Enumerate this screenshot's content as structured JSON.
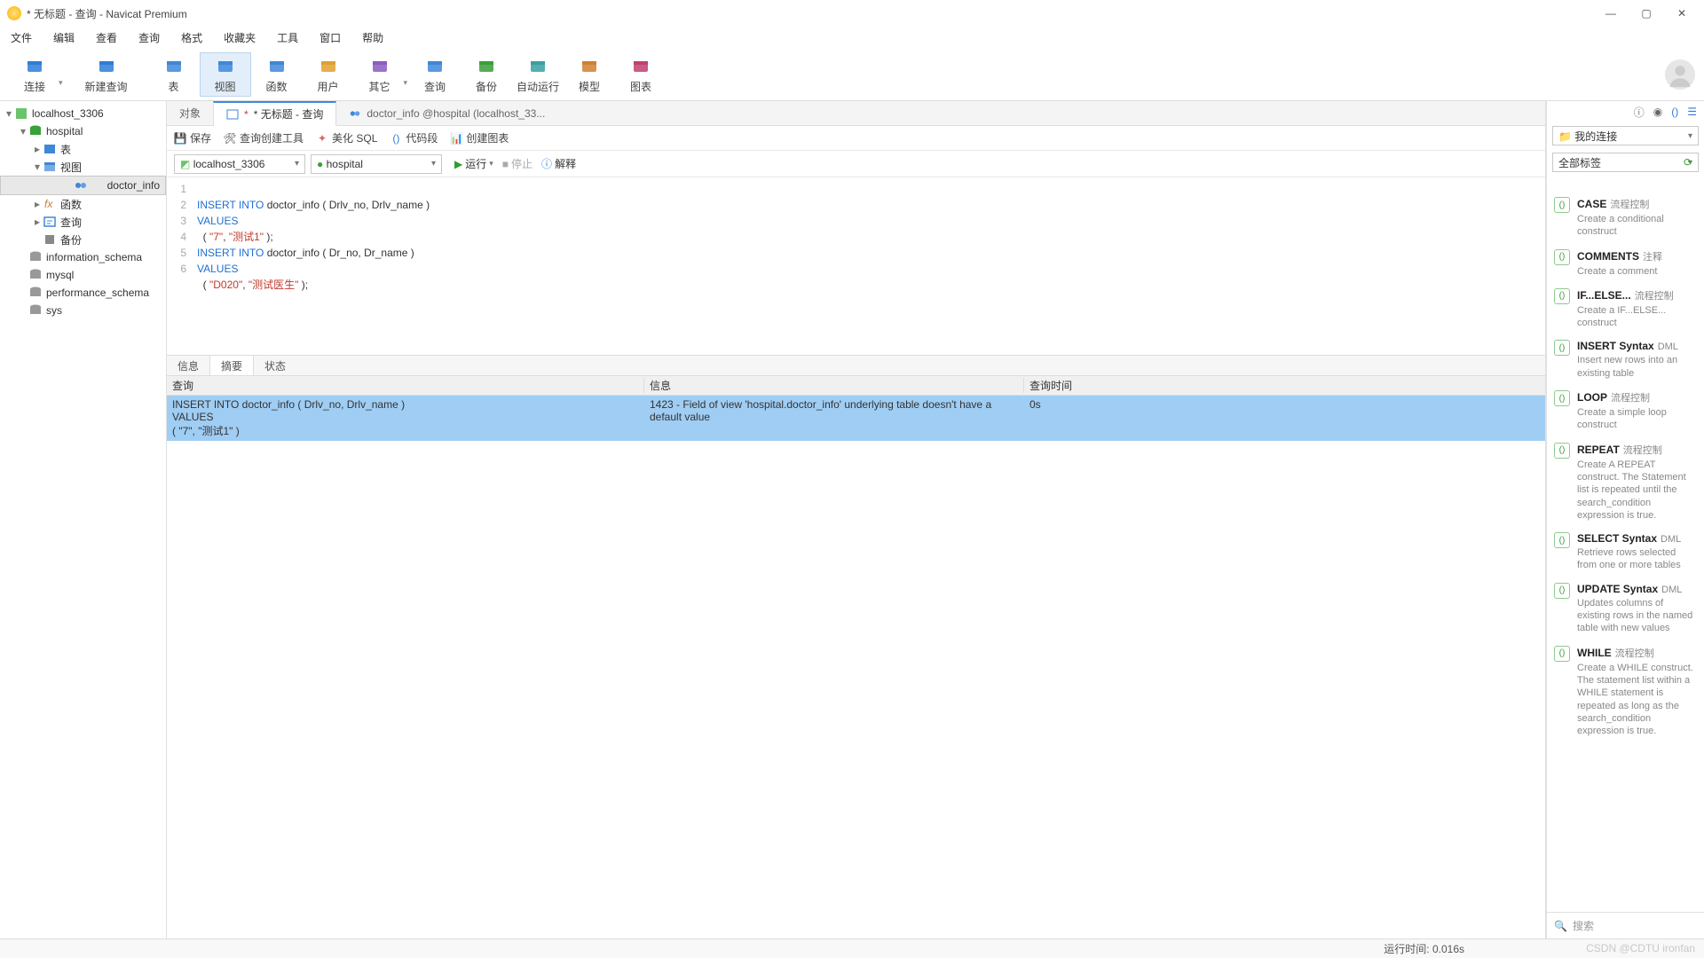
{
  "window": {
    "title": "* 无标题 - 查询 - Navicat Premium"
  },
  "menu": [
    "文件",
    "编辑",
    "查看",
    "查询",
    "格式",
    "收藏夹",
    "工具",
    "窗口",
    "帮助"
  ],
  "toolbar": [
    {
      "label": "连接",
      "icon": "plug"
    },
    {
      "label": "新建查询",
      "icon": "newquery"
    },
    {
      "label": "表",
      "icon": "table"
    },
    {
      "label": "视图",
      "icon": "view",
      "active": true
    },
    {
      "label": "函数",
      "icon": "fx"
    },
    {
      "label": "用户",
      "icon": "user"
    },
    {
      "label": "其它",
      "icon": "other"
    },
    {
      "label": "查询",
      "icon": "query"
    },
    {
      "label": "备份",
      "icon": "backup"
    },
    {
      "label": "自动运行",
      "icon": "robot"
    },
    {
      "label": "模型",
      "icon": "model"
    },
    {
      "label": "图表",
      "icon": "chart"
    }
  ],
  "tree": [
    {
      "d": 0,
      "arr": "▾",
      "icon": "conn",
      "label": "localhost_3306"
    },
    {
      "d": 1,
      "arr": "▾",
      "icon": "db",
      "label": "hospital"
    },
    {
      "d": 2,
      "arr": "▸",
      "icon": "tbl",
      "label": "表"
    },
    {
      "d": 2,
      "arr": "▾",
      "icon": "view",
      "label": "视图"
    },
    {
      "d": 3,
      "arr": "",
      "icon": "viewitem",
      "label": "doctor_info",
      "sel": true
    },
    {
      "d": 2,
      "arr": "▸",
      "icon": "fx",
      "label": "函数"
    },
    {
      "d": 2,
      "arr": "▸",
      "icon": "qry",
      "label": "查询"
    },
    {
      "d": 2,
      "arr": "",
      "icon": "bak",
      "label": "备份"
    },
    {
      "d": 1,
      "arr": "",
      "icon": "dbg",
      "label": "information_schema"
    },
    {
      "d": 1,
      "arr": "",
      "icon": "dbg",
      "label": "mysql"
    },
    {
      "d": 1,
      "arr": "",
      "icon": "dbg",
      "label": "performance_schema"
    },
    {
      "d": 1,
      "arr": "",
      "icon": "dbg",
      "label": "sys"
    }
  ],
  "tabs": [
    {
      "label": "对象",
      "icon": ""
    },
    {
      "label": "* 无标题 - 查询",
      "icon": "query",
      "active": true
    },
    {
      "label": "doctor_info @hospital (localhost_33...",
      "icon": "viewitem"
    }
  ],
  "qtoolbar": {
    "save": "保存",
    "tool": "查询创建工具",
    "beautify": "美化 SQL",
    "snippet": "代码段",
    "chart": "创建图表"
  },
  "conn": {
    "connection": "localhost_3306",
    "database": "hospital",
    "run": "运行",
    "stop": "停止",
    "explain": "解释"
  },
  "code_lines": [
    "1",
    "2",
    "3",
    "4",
    "5",
    "6"
  ],
  "code": {
    "l1": {
      "a": "INSERT INTO",
      "b": " doctor_info ( Drlv_no, Drlv_name )"
    },
    "l2": "VALUES",
    "l3": {
      "a": "  ( ",
      "b": "\"7\"",
      "c": ", ",
      "d": "\"测试1\"",
      "e": " );"
    },
    "l4": {
      "a": "INSERT INTO",
      "b": " doctor_info ( Dr_no, Dr_name )"
    },
    "l5": "VALUES",
    "l6": {
      "a": "  ( ",
      "b": "\"D020\"",
      "c": ", ",
      "d": "\"测试医生\"",
      "e": " );"
    }
  },
  "rtabs": [
    "信息",
    "摘要",
    "状态"
  ],
  "rhead": {
    "c1": "查询",
    "c2": "信息",
    "c3": "查询时间"
  },
  "rrow": {
    "c1": "INSERT INTO doctor_info ( Drlv_no, Drlv_name )\nVALUES\n( \"7\", \"测试1\" )",
    "c2": "1423 - Field of view 'hospital.doctor_info' underlying table doesn't have a default value",
    "c3": "0s"
  },
  "right": {
    "conn_sel": "我的连接",
    "tag_sel": "全部标签",
    "snips": [
      {
        "t": "CASE",
        "tag": "流程控制",
        "d": "Create a conditional construct"
      },
      {
        "t": "COMMENTS",
        "tag": "注释",
        "d": "Create a comment"
      },
      {
        "t": "IF...ELSE...",
        "tag": "流程控制",
        "d": "Create a IF...ELSE... construct"
      },
      {
        "t": "INSERT Syntax",
        "tag": "DML",
        "d": "Insert new rows into an existing table"
      },
      {
        "t": "LOOP",
        "tag": "流程控制",
        "d": "Create a simple loop construct"
      },
      {
        "t": "REPEAT",
        "tag": "流程控制",
        "d": "Create A REPEAT construct. The Statement list is repeated until the search_condition expression is true."
      },
      {
        "t": "SELECT Syntax",
        "tag": "DML",
        "d": "Retrieve rows selected from one or more tables"
      },
      {
        "t": "UPDATE Syntax",
        "tag": "DML",
        "d": "Updates columns of existing rows in the named table with new values"
      },
      {
        "t": "WHILE",
        "tag": "流程控制",
        "d": "Create a WHILE construct. The statement list within a WHILE statement is repeated as long as the search_condition expression is true."
      }
    ],
    "search": "搜索"
  },
  "status": {
    "runtime": "运行时间: 0.016s"
  },
  "watermark": "CSDN @CDTU ironfan"
}
